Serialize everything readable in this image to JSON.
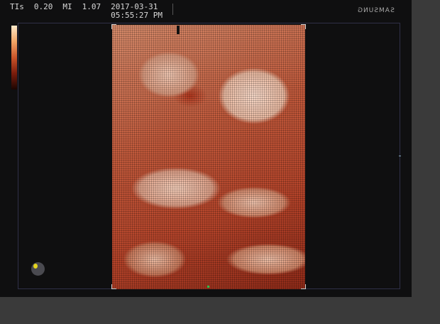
{
  "header": {
    "tis": "TIs",
    "tis_value": "0.20",
    "mi": "MI",
    "mi_value": "1.07",
    "date": "2017-03-31",
    "time": "05:55:27 PM"
  },
  "brand": "SAMSUNG",
  "colors": {
    "background": "#0f0f10",
    "render_tone": "#c25a3c"
  },
  "icons": {
    "orientation_marker": "orientation-marker-icon"
  }
}
